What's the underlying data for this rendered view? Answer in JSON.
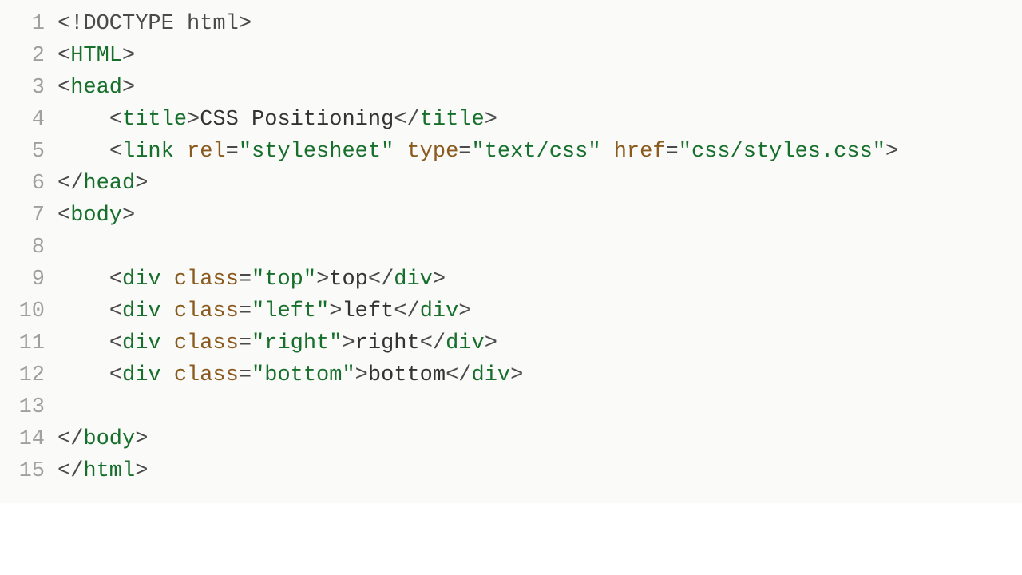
{
  "editor": {
    "lines": [
      {
        "n": 1,
        "tokens": [
          {
            "c": "t-punct",
            "t": "<"
          },
          {
            "c": "t-doctype",
            "t": "!DOCTYPE html"
          },
          {
            "c": "t-punct",
            "t": ">"
          }
        ]
      },
      {
        "n": 2,
        "tokens": [
          {
            "c": "t-punct",
            "t": "<"
          },
          {
            "c": "t-tag",
            "t": "HTML"
          },
          {
            "c": "t-punct",
            "t": ">"
          }
        ]
      },
      {
        "n": 3,
        "tokens": [
          {
            "c": "t-punct",
            "t": "<"
          },
          {
            "c": "t-tag",
            "t": "head"
          },
          {
            "c": "t-punct",
            "t": ">"
          }
        ]
      },
      {
        "n": 4,
        "tokens": [
          {
            "c": "t-text",
            "t": "    "
          },
          {
            "c": "t-punct",
            "t": "<"
          },
          {
            "c": "t-tag",
            "t": "title"
          },
          {
            "c": "t-punct",
            "t": ">"
          },
          {
            "c": "t-text",
            "t": "CSS Positioning"
          },
          {
            "c": "t-punct",
            "t": "</"
          },
          {
            "c": "t-tag",
            "t": "title"
          },
          {
            "c": "t-punct",
            "t": ">"
          }
        ]
      },
      {
        "n": 5,
        "tokens": [
          {
            "c": "t-text",
            "t": "    "
          },
          {
            "c": "t-punct",
            "t": "<"
          },
          {
            "c": "t-tag",
            "t": "link"
          },
          {
            "c": "t-text",
            "t": " "
          },
          {
            "c": "t-attr",
            "t": "rel"
          },
          {
            "c": "t-equals",
            "t": "="
          },
          {
            "c": "t-string",
            "t": "\"stylesheet\""
          },
          {
            "c": "t-text",
            "t": " "
          },
          {
            "c": "t-attr",
            "t": "type"
          },
          {
            "c": "t-equals",
            "t": "="
          },
          {
            "c": "t-string",
            "t": "\"text/css\""
          },
          {
            "c": "t-text",
            "t": " "
          },
          {
            "c": "t-attr",
            "t": "href"
          },
          {
            "c": "t-equals",
            "t": "="
          },
          {
            "c": "t-string",
            "t": "\"css/styles.css\""
          },
          {
            "c": "t-punct",
            "t": ">"
          }
        ]
      },
      {
        "n": 6,
        "tokens": [
          {
            "c": "t-punct",
            "t": "</"
          },
          {
            "c": "t-tag",
            "t": "head"
          },
          {
            "c": "t-punct",
            "t": ">"
          }
        ]
      },
      {
        "n": 7,
        "tokens": [
          {
            "c": "t-punct",
            "t": "<"
          },
          {
            "c": "t-tag",
            "t": "body"
          },
          {
            "c": "t-punct",
            "t": ">"
          }
        ]
      },
      {
        "n": 8,
        "tokens": []
      },
      {
        "n": 9,
        "tokens": [
          {
            "c": "t-text",
            "t": "    "
          },
          {
            "c": "t-punct",
            "t": "<"
          },
          {
            "c": "t-tag",
            "t": "div"
          },
          {
            "c": "t-text",
            "t": " "
          },
          {
            "c": "t-attr",
            "t": "class"
          },
          {
            "c": "t-equals",
            "t": "="
          },
          {
            "c": "t-string",
            "t": "\"top\""
          },
          {
            "c": "t-punct",
            "t": ">"
          },
          {
            "c": "t-text",
            "t": "top"
          },
          {
            "c": "t-punct",
            "t": "</"
          },
          {
            "c": "t-tag",
            "t": "div"
          },
          {
            "c": "t-punct",
            "t": ">"
          }
        ]
      },
      {
        "n": 10,
        "tokens": [
          {
            "c": "t-text",
            "t": "    "
          },
          {
            "c": "t-punct",
            "t": "<"
          },
          {
            "c": "t-tag",
            "t": "div"
          },
          {
            "c": "t-text",
            "t": " "
          },
          {
            "c": "t-attr",
            "t": "class"
          },
          {
            "c": "t-equals",
            "t": "="
          },
          {
            "c": "t-string",
            "t": "\"left\""
          },
          {
            "c": "t-punct",
            "t": ">"
          },
          {
            "c": "t-text",
            "t": "left"
          },
          {
            "c": "t-punct",
            "t": "</"
          },
          {
            "c": "t-tag",
            "t": "div"
          },
          {
            "c": "t-punct",
            "t": ">"
          }
        ]
      },
      {
        "n": 11,
        "tokens": [
          {
            "c": "t-text",
            "t": "    "
          },
          {
            "c": "t-punct",
            "t": "<"
          },
          {
            "c": "t-tag",
            "t": "div"
          },
          {
            "c": "t-text",
            "t": " "
          },
          {
            "c": "t-attr",
            "t": "class"
          },
          {
            "c": "t-equals",
            "t": "="
          },
          {
            "c": "t-string",
            "t": "\"right\""
          },
          {
            "c": "t-punct",
            "t": ">"
          },
          {
            "c": "t-text",
            "t": "right"
          },
          {
            "c": "t-punct",
            "t": "</"
          },
          {
            "c": "t-tag",
            "t": "div"
          },
          {
            "c": "t-punct",
            "t": ">"
          }
        ]
      },
      {
        "n": 12,
        "tokens": [
          {
            "c": "t-text",
            "t": "    "
          },
          {
            "c": "t-punct",
            "t": "<"
          },
          {
            "c": "t-tag",
            "t": "div"
          },
          {
            "c": "t-text",
            "t": " "
          },
          {
            "c": "t-attr",
            "t": "class"
          },
          {
            "c": "t-equals",
            "t": "="
          },
          {
            "c": "t-string",
            "t": "\"bottom\""
          },
          {
            "c": "t-punct",
            "t": ">"
          },
          {
            "c": "t-text",
            "t": "bottom"
          },
          {
            "c": "t-punct",
            "t": "</"
          },
          {
            "c": "t-tag",
            "t": "div"
          },
          {
            "c": "t-punct",
            "t": ">"
          }
        ]
      },
      {
        "n": 13,
        "tokens": []
      },
      {
        "n": 14,
        "tokens": [
          {
            "c": "t-punct",
            "t": "</"
          },
          {
            "c": "t-tag",
            "t": "body"
          },
          {
            "c": "t-punct",
            "t": ">"
          }
        ]
      },
      {
        "n": 15,
        "tokens": [
          {
            "c": "t-punct",
            "t": "</"
          },
          {
            "c": "t-tag",
            "t": "html"
          },
          {
            "c": "t-punct",
            "t": ">"
          }
        ]
      }
    ]
  }
}
